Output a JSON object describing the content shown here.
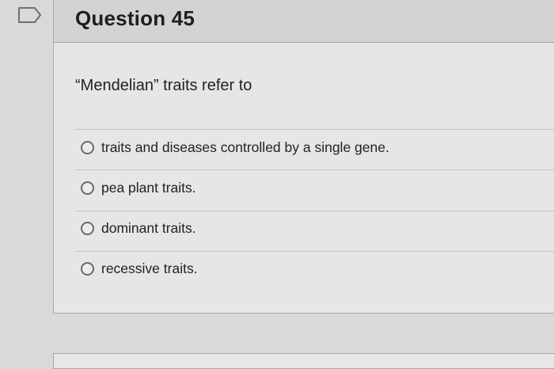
{
  "question": {
    "title": "Question 45",
    "prompt": "“Mendelian” traits refer to",
    "answers": [
      {
        "label": "traits and diseases controlled by a single gene."
      },
      {
        "label": "pea plant traits."
      },
      {
        "label": "dominant traits."
      },
      {
        "label": "recessive traits."
      }
    ]
  },
  "icons": {
    "flag": "flag-outline-icon"
  }
}
